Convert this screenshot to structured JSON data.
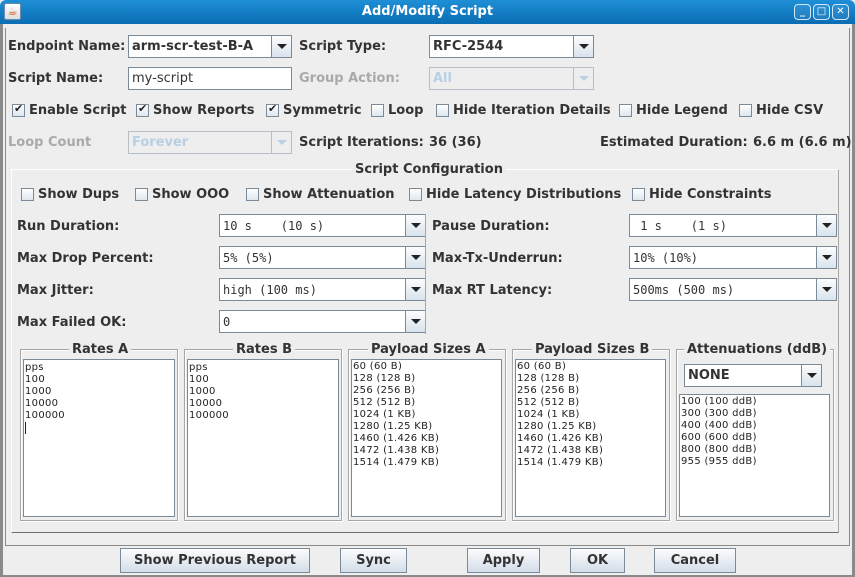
{
  "window": {
    "title": "Add/Modify Script",
    "app_icon": "java-cup-icon",
    "controls": {
      "minimize": "_",
      "maximize": "□",
      "close": "✕"
    }
  },
  "top": {
    "endpoint_label": "Endpoint Name:",
    "endpoint_value": "arm-scr-test-B-A",
    "script_type_label": "Script Type:",
    "script_type_value": "RFC-2544",
    "script_name_label": "Script Name:",
    "script_name_value": "my-script",
    "group_action_label": "Group Action:",
    "group_action_value": "All",
    "checkboxes": [
      {
        "label": "Enable Script",
        "checked": true
      },
      {
        "label": "Show Reports",
        "checked": true
      },
      {
        "label": "Symmetric",
        "checked": true
      },
      {
        "label": "Loop",
        "checked": false
      },
      {
        "label": "Hide Iteration Details",
        "checked": false
      },
      {
        "label": "Hide Legend",
        "checked": false
      },
      {
        "label": "Hide CSV",
        "checked": false
      }
    ],
    "loop_count_label": "Loop Count",
    "loop_count_value": "Forever",
    "iterations_label": "Script Iterations:",
    "iterations_value": "36 (36)",
    "duration_label": "Estimated Duration:",
    "duration_value": "6.6 m (6.6 m)"
  },
  "config": {
    "title": "Script Configuration",
    "checkboxes": [
      {
        "label": "Show Dups",
        "checked": false
      },
      {
        "label": "Show OOO",
        "checked": false
      },
      {
        "label": "Show Attenuation",
        "checked": false
      },
      {
        "label": "Hide Latency Distributions",
        "checked": false
      },
      {
        "label": "Hide Constraints",
        "checked": false
      }
    ],
    "fields": {
      "run_duration": {
        "label": "Run Duration:",
        "value": "10 s    (10 s)"
      },
      "pause_duration": {
        "label": "Pause Duration:",
        "value": " 1 s    (1 s)"
      },
      "max_drop": {
        "label": "Max Drop Percent:",
        "value": "5% (5%)"
      },
      "max_tx_underrun": {
        "label": "Max-Tx-Underrun:",
        "value": "10% (10%)"
      },
      "max_jitter": {
        "label": "Max Jitter:",
        "value": "high (100 ms)"
      },
      "max_rt_latency": {
        "label": "Max RT Latency:",
        "value": "500ms (500 ms)"
      },
      "max_failed_ok": {
        "label": "Max Failed OK:",
        "value": "0"
      }
    },
    "rates_a": {
      "title": "Rates A",
      "lines": [
        "pps",
        "100",
        "1000",
        "10000",
        "100000"
      ]
    },
    "rates_b": {
      "title": "Rates B",
      "lines": [
        "pps",
        "100",
        "1000",
        "10000",
        "100000"
      ]
    },
    "payload_a": {
      "title": "Payload Sizes A",
      "lines": [
        "60 (60 B)",
        "128 (128 B)",
        "256 (256 B)",
        "512 (512 B)",
        "1024 (1 KB)",
        "1280 (1.25 KB)",
        "1460 (1.426 KB)",
        "1472 (1.438 KB)",
        "1514 (1.479 KB)"
      ]
    },
    "payload_b": {
      "title": "Payload Sizes B",
      "lines": [
        "60 (60 B)",
        "128 (128 B)",
        "256 (256 B)",
        "512 (512 B)",
        "1024 (1 KB)",
        "1280 (1.25 KB)",
        "1460 (1.426 KB)",
        "1472 (1.438 KB)",
        "1514 (1.479 KB)"
      ]
    },
    "attenuations": {
      "title": "Attenuations (ddB)",
      "selector_value": "NONE",
      "lines": [
        "100 (100 ddB)",
        "300 (300 ddB)",
        "400 (400 ddB)",
        "600 (600 ddB)",
        "800 (800 ddB)",
        "955 (955 ddB)"
      ]
    }
  },
  "buttons": {
    "show_previous_report": "Show Previous Report",
    "sync": "Sync",
    "apply": "Apply",
    "ok": "OK",
    "cancel": "Cancel"
  }
}
